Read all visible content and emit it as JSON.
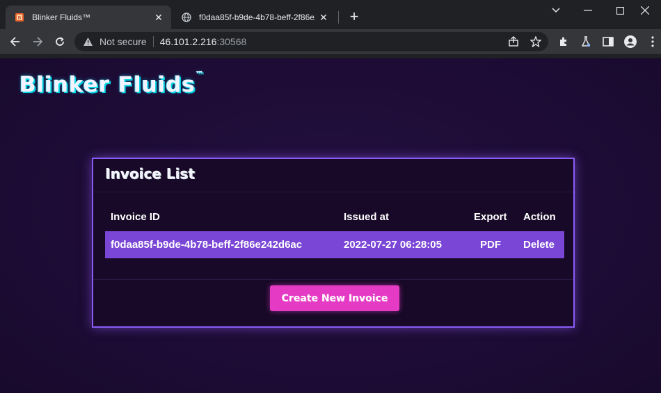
{
  "browser": {
    "tabs": [
      {
        "title": "Blinker Fluids™",
        "active": true
      },
      {
        "title": "f0daa85f-b9de-4b78-beff-2f86e2",
        "active": false
      }
    ],
    "address": {
      "security_label": "Not secure",
      "host": "46.101.2.216",
      "port": ":30568"
    }
  },
  "page": {
    "logo": "Blinker Fluids",
    "logo_tm": "™",
    "card_title": "Invoice List",
    "table": {
      "headers": [
        "Invoice ID",
        "Issued at",
        "Export",
        "Action"
      ],
      "rows": [
        {
          "id": "f0daa85f-b9de-4b78-beff-2f86e242d6ac",
          "issued": "2022-07-27 06:28:05",
          "export": "PDF",
          "action": "Delete"
        }
      ]
    },
    "create_button": "Create New Invoice"
  },
  "colors": {
    "background": "#1f0d36",
    "card_border": "#8a5cf6",
    "row_highlight": "#7a46d6",
    "button": "#e43ac4",
    "logo_glow": "#00d7e6"
  }
}
